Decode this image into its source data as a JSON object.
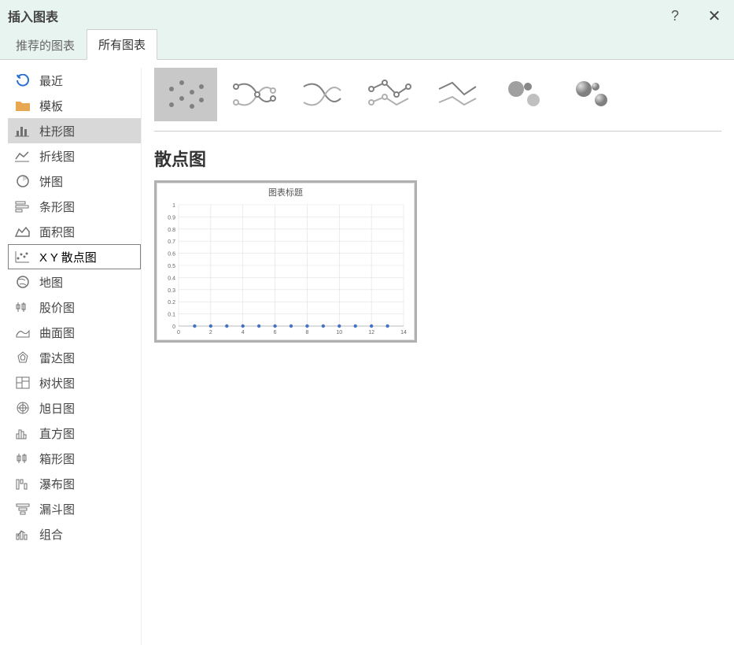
{
  "titlebar": {
    "title": "插入图表",
    "help": "?",
    "close": "✕"
  },
  "tabs": {
    "recommended": "推荐的图表",
    "all": "所有图表"
  },
  "sidebar": {
    "items": [
      {
        "label": "最近"
      },
      {
        "label": "模板"
      },
      {
        "label": "柱形图"
      },
      {
        "label": "折线图"
      },
      {
        "label": "饼图"
      },
      {
        "label": "条形图"
      },
      {
        "label": "面积图"
      },
      {
        "label": "X Y 散点图"
      },
      {
        "label": "地图"
      },
      {
        "label": "股价图"
      },
      {
        "label": "曲面图"
      },
      {
        "label": "雷达图"
      },
      {
        "label": "树状图"
      },
      {
        "label": "旭日图"
      },
      {
        "label": "直方图"
      },
      {
        "label": "箱形图"
      },
      {
        "label": "瀑布图"
      },
      {
        "label": "漏斗图"
      },
      {
        "label": "组合"
      }
    ]
  },
  "main": {
    "chart_type_label": "散点图"
  },
  "chart_data": {
    "type": "scatter",
    "title": "图表标题",
    "xlabel": "",
    "ylabel": "",
    "xlim": [
      0,
      14
    ],
    "ylim": [
      0,
      1
    ],
    "xticks": [
      0,
      2,
      4,
      6,
      8,
      10,
      12,
      14
    ],
    "yticks": [
      0,
      0.1,
      0.2,
      0.3,
      0.4,
      0.5,
      0.6,
      0.7,
      0.8,
      0.9,
      1
    ],
    "x": [
      1,
      2,
      3,
      4,
      5,
      6,
      7,
      8,
      9,
      10,
      11,
      12,
      13
    ],
    "y": [
      0,
      0,
      0,
      0,
      0,
      0,
      0,
      0,
      0,
      0,
      0,
      0,
      0
    ]
  }
}
